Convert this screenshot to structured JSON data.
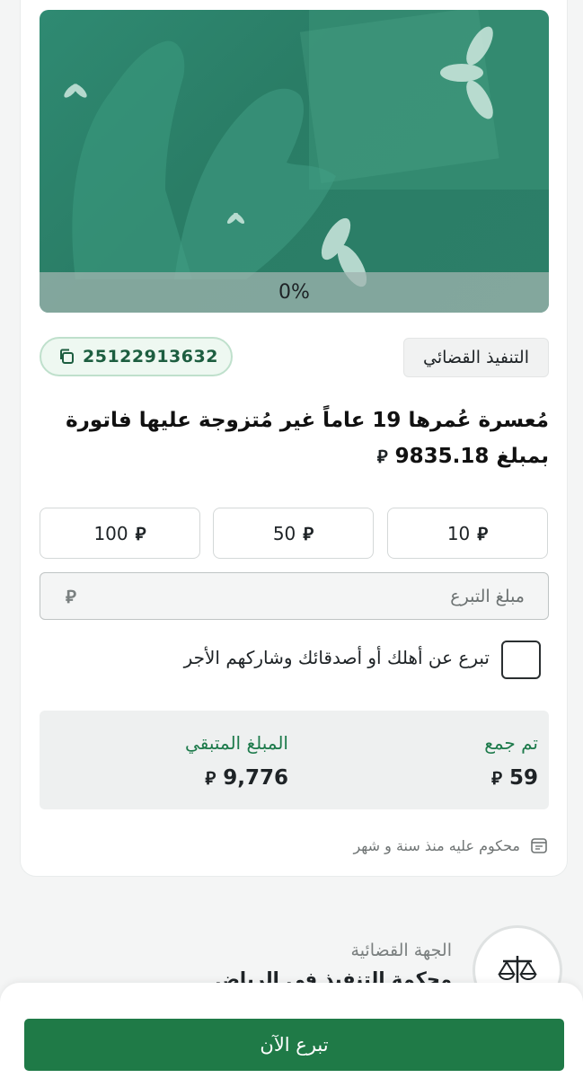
{
  "hero": {
    "progress_text": "0%"
  },
  "case": {
    "id": "25122913632",
    "category": "التنفيذ القضائي",
    "title_line1": "مُعسرة عُمرها 19 عاماً غير مُتزوجة عليها فاتورة",
    "title_line2": "بمبلغ 9835.18",
    "currency_symbol": "⃁"
  },
  "amount_options": [
    "10",
    "50",
    "100"
  ],
  "amount_input": {
    "placeholder": "مبلغ التبرع"
  },
  "gift_option": {
    "label": "تبرع عن أهلك أو أصدقائك وشاركهم الأجر"
  },
  "stats": {
    "collected_label": "تم جمع",
    "collected_value": "59",
    "remaining_label": "المبلغ المتبقي",
    "remaining_value": "9,776"
  },
  "meta": {
    "text": "محكوم عليه منذ سنة و شهر"
  },
  "entity": {
    "label": "الجهة القضائية",
    "value": "محكمة التنفيذ في الرياض"
  },
  "cta": {
    "label": "تبرع الآن"
  },
  "colors": {
    "accent": "#1f7a47",
    "hero": "#2c7f68"
  }
}
